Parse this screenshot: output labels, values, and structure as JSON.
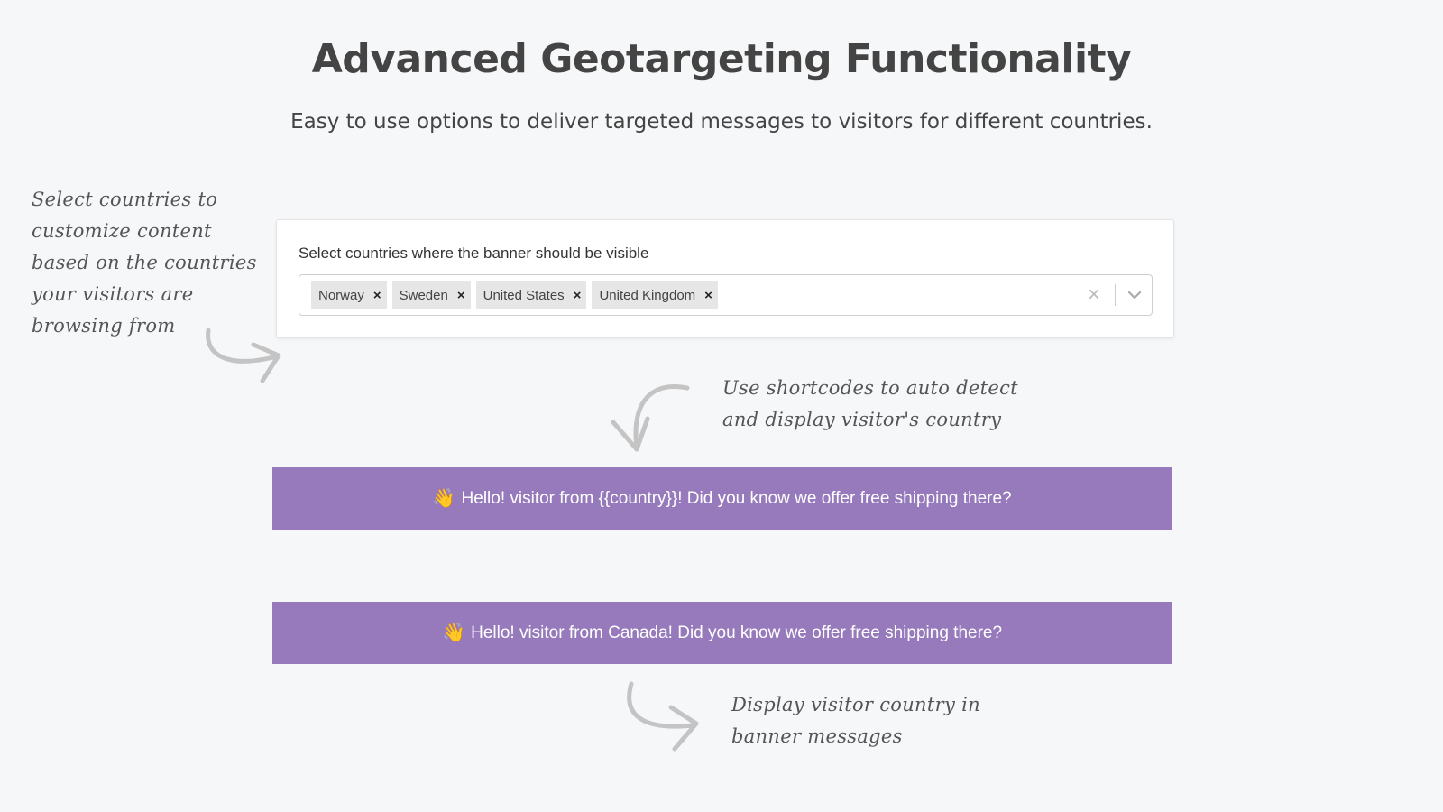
{
  "header": {
    "title": "Advanced  Geotargeting Functionality",
    "subtitle": "Easy to use options to deliver targeted messages to visitors for different countries."
  },
  "notes": {
    "select_countries": "Select countries to customize content based on the countries your visitors are browsing from",
    "shortcodes": "Use shortcodes to auto detect and display visitor's country",
    "display_country": "Display visitor country in banner messages"
  },
  "country_selector": {
    "label": "Select countries where the banner should be visible",
    "selected": [
      "Norway",
      "Sweden",
      "United States",
      "United Kingdom"
    ],
    "remove_glyph": "×",
    "clear_glyph": "×"
  },
  "banners": {
    "template": {
      "icon": "👋",
      "text": "Hello! visitor from {{country}}! Did you know we offer free shipping there?"
    },
    "preview": {
      "icon": "👋",
      "text": "Hello! visitor from Canada! Did you know we offer free shipping there?"
    }
  },
  "colors": {
    "banner_bg": "#967abc",
    "page_bg": "#f6f7f9",
    "tag_bg": "#e6e6e6"
  }
}
